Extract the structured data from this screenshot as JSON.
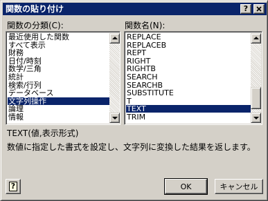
{
  "window": {
    "title": "関数の貼り付け",
    "help_button": "?",
    "close_button": "x"
  },
  "categories": {
    "label": "関数の分類(C):",
    "items": [
      "最近使用した関数",
      "すべて表示",
      "財務",
      "日付/時刻",
      "数学/三角",
      "統計",
      "検索/行列",
      "データベース",
      "文字列操作",
      "論理",
      "情報"
    ],
    "selected": "文字列操作"
  },
  "functions": {
    "label": "関数名(N):",
    "items": [
      "REPLACE",
      "REPLACEB",
      "REPT",
      "RIGHT",
      "RIGHTB",
      "SEARCH",
      "SEARCHB",
      "SUBSTITUTE",
      "T",
      "TEXT",
      "TRIM"
    ],
    "selected": "TEXT"
  },
  "description": {
    "syntax": "TEXT(値,表示形式)",
    "text": "数値に指定した書式を設定し、文字列に変換した結果を返します。"
  },
  "buttons": {
    "ok": "OK",
    "cancel": "キャンセル"
  },
  "colors": {
    "titlebar": "#0a246a",
    "face": "#d4d0c8",
    "selection": "#0a246a"
  }
}
